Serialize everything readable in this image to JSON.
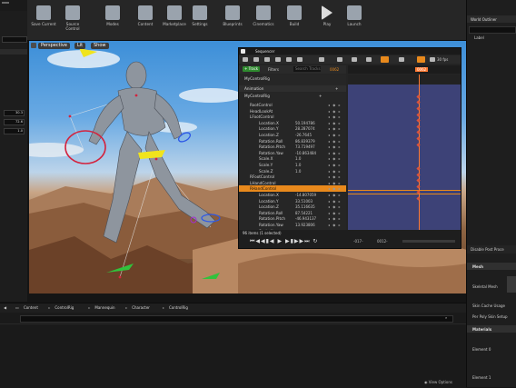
{
  "toolbar": {
    "buttons": [
      {
        "label": "Save Current",
        "icon": "save-icon"
      },
      {
        "label": "Source Control",
        "icon": "source-control-icon"
      },
      {
        "label": "Modes",
        "icon": "modes-icon"
      },
      {
        "label": "Content",
        "icon": "content-icon"
      },
      {
        "label": "Marketplace",
        "icon": "marketplace-icon"
      },
      {
        "label": "Settings",
        "icon": "settings-icon"
      },
      {
        "label": "Blueprints",
        "icon": "blueprints-icon"
      },
      {
        "label": "Cinematics",
        "icon": "cinematics-icon"
      },
      {
        "label": "Build",
        "icon": "build-icon"
      },
      {
        "label": "Play",
        "icon": "play-icon"
      },
      {
        "label": "Launch",
        "icon": "launch-icon"
      }
    ]
  },
  "left_panel": {
    "values": [
      "30.3",
      "72.6",
      "1.0"
    ]
  },
  "viewport": {
    "perspective_label": "Perspective",
    "lit_label": "Lit",
    "show_label": "Show"
  },
  "sequencer": {
    "title": "Sequencer",
    "track_button": "+ Track",
    "filters_label": "Filters",
    "search_placeholder": "Search Tracks",
    "frame_rate": "30 fps",
    "current_frame": "0062",
    "frame_counter": "0062",
    "root_item": "MyControlRig",
    "animation_label": "Animation",
    "rig_item": "MyControlRig",
    "tracks": [
      {
        "name": "RootControl",
        "indent": 1
      },
      {
        "name": "HeadLookAt",
        "indent": 1
      },
      {
        "name": "LFootControl",
        "indent": 1,
        "expanded": true
      },
      {
        "name": "Location.X",
        "indent": 2,
        "value": "50.194786"
      },
      {
        "name": "Location.Y",
        "indent": 2,
        "value": "28.287074"
      },
      {
        "name": "Location.Z",
        "indent": 2,
        "value": "-26.7645"
      },
      {
        "name": "Rotation.Roll",
        "indent": 2,
        "value": "86.839379"
      },
      {
        "name": "Rotation.Pitch",
        "indent": 2,
        "value": "73.719497"
      },
      {
        "name": "Rotation.Yaw",
        "indent": 2,
        "value": "-10.863484"
      },
      {
        "name": "Scale.X",
        "indent": 2,
        "value": "1.0"
      },
      {
        "name": "Scale.Y",
        "indent": 2,
        "value": "1.0"
      },
      {
        "name": "Scale.Z",
        "indent": 2,
        "value": "1.0"
      },
      {
        "name": "RFootControl",
        "indent": 1
      },
      {
        "name": "LHandControl",
        "indent": 1
      },
      {
        "name": "RHandControl",
        "indent": 1,
        "selected": true
      },
      {
        "name": "Location.X",
        "indent": 2,
        "value": "-14.807059"
      },
      {
        "name": "Location.Y",
        "indent": 2,
        "value": "33.51003"
      },
      {
        "name": "Location.Z",
        "indent": 2,
        "value": "35.116635"
      },
      {
        "name": "Rotation.Roll",
        "indent": 2,
        "value": "87.54221"
      },
      {
        "name": "Rotation.Pitch",
        "indent": 2,
        "value": "-46.943137"
      },
      {
        "name": "Rotation.Yaw",
        "indent": 2,
        "value": "13.923806"
      },
      {
        "name": "Scale.X",
        "indent": 2,
        "value": ""
      }
    ],
    "status": "96 items (1 selected)",
    "range_start": "-017-",
    "range_end": "0012-"
  },
  "content_browser": {
    "path": [
      "Content",
      "ControlRig",
      "Mannequin",
      "Character",
      "ControlRig"
    ],
    "view_options": "View Options"
  },
  "right_panel": {
    "world_outliner": "World Outliner",
    "label_header": "Label",
    "disable_post_process": "Disable Post Proce",
    "mesh_section": "Mesh",
    "skeletal_mesh": "Skeletal Mesh",
    "skin_cache": "Skin Cache Usage",
    "per_poly": "Per Poly Skin Setup",
    "materials_section": "Materials",
    "element0": "Element 0",
    "element1": "Element 1"
  },
  "colors": {
    "accent_orange": "#e8891c",
    "track_area": "#3d4277",
    "playhead": "#ff7a33",
    "key_red": "#d9533c"
  }
}
